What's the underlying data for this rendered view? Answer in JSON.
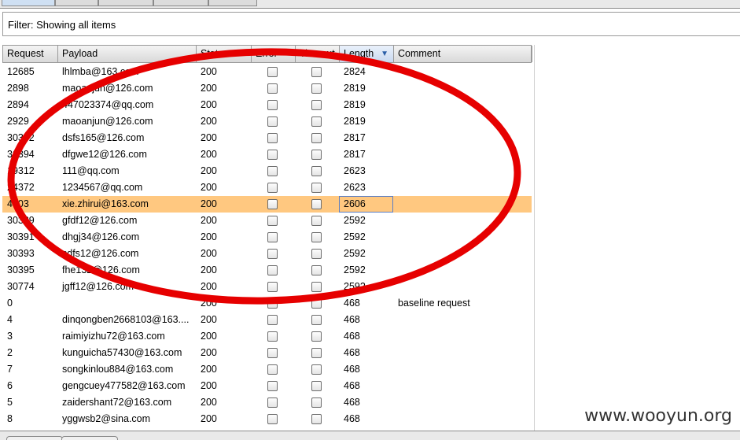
{
  "filter": {
    "label": "Filter: Showing all items"
  },
  "columns": {
    "request": "Request",
    "payload": "Payload",
    "status": "Status",
    "error": "Error",
    "timeout": "Timeout",
    "length": "Length",
    "comment": "Comment"
  },
  "rows": [
    {
      "request": "12685",
      "payload": "lhlmba@163.com",
      "status": "200",
      "length": "2824",
      "comment": ""
    },
    {
      "request": "2898",
      "payload": "maoanjun@126.com",
      "status": "200",
      "length": "2819",
      "comment": ""
    },
    {
      "request": "2894",
      "payload": "447023374@qq.com",
      "status": "200",
      "length": "2819",
      "comment": ""
    },
    {
      "request": "2929",
      "payload": "maoanjun@126.com",
      "status": "200",
      "length": "2819",
      "comment": ""
    },
    {
      "request": "30392",
      "payload": "dsfs165@126.com",
      "status": "200",
      "length": "2817",
      "comment": ""
    },
    {
      "request": "30394",
      "payload": "dfgwe12@126.com",
      "status": "200",
      "length": "2817",
      "comment": ""
    },
    {
      "request": "19312",
      "payload": "111@qq.com",
      "status": "200",
      "length": "2623",
      "comment": ""
    },
    {
      "request": "24372",
      "payload": "1234567@qq.com",
      "status": "200",
      "length": "2623",
      "comment": ""
    },
    {
      "request": "4603",
      "payload": "xie.zhirui@163.com",
      "status": "200",
      "length": "2606",
      "comment": ""
    },
    {
      "request": "30389",
      "payload": "gfdf12@126.com",
      "status": "200",
      "length": "2592",
      "comment": ""
    },
    {
      "request": "30391",
      "payload": "dhgj34@126.com",
      "status": "200",
      "length": "2592",
      "comment": ""
    },
    {
      "request": "30393",
      "payload": "sdfs12@126.com",
      "status": "200",
      "length": "2592",
      "comment": ""
    },
    {
      "request": "30395",
      "payload": "fhe132@126.com",
      "status": "200",
      "length": "2592",
      "comment": ""
    },
    {
      "request": "30774",
      "payload": "jgff12@126.com",
      "status": "200",
      "length": "2592",
      "comment": ""
    },
    {
      "request": "0",
      "payload": "",
      "status": "200",
      "length": "468",
      "comment": "baseline request"
    },
    {
      "request": "4",
      "payload": "dinqongben2668103@163....",
      "status": "200",
      "length": "468",
      "comment": ""
    },
    {
      "request": "3",
      "payload": "raimiyizhu72@163.com",
      "status": "200",
      "length": "468",
      "comment": ""
    },
    {
      "request": "2",
      "payload": "kunguicha57430@163.com",
      "status": "200",
      "length": "468",
      "comment": ""
    },
    {
      "request": "7",
      "payload": "songkinlou884@163.com",
      "status": "200",
      "length": "468",
      "comment": ""
    },
    {
      "request": "6",
      "payload": "gengcuey477582@163.com",
      "status": "200",
      "length": "468",
      "comment": ""
    },
    {
      "request": "5",
      "payload": "zaidershant72@163.com",
      "status": "200",
      "length": "468",
      "comment": ""
    },
    {
      "request": "8",
      "payload": "yggwsb2@sina.com",
      "status": "200",
      "length": "468",
      "comment": ""
    }
  ],
  "selected_row": 8,
  "sort": {
    "column": "Length",
    "direction": "descending"
  },
  "watermark": "www.wooyun.org",
  "colors": {
    "selection": "#ffc880",
    "annotation": "#e60000",
    "header": "#dedede"
  }
}
